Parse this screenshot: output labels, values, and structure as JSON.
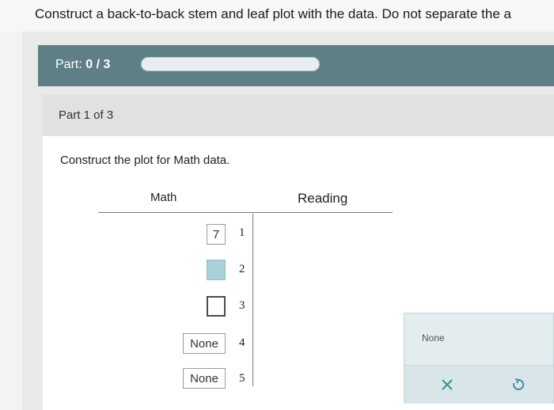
{
  "instruction": "Construct a back-to-back stem and leaf plot with the data. Do not separate the a",
  "part": {
    "label": "Part:",
    "score": "0 / 3",
    "progress": 0
  },
  "section": {
    "header": "Part 1 of 3",
    "prompt": "Construct the plot for Math data."
  },
  "plot": {
    "left_header": "Math",
    "right_header": "Reading",
    "rows": [
      {
        "stem": "1",
        "leaf": "7"
      },
      {
        "stem": "2",
        "leaf": ""
      },
      {
        "stem": "3",
        "leaf": ""
      },
      {
        "stem": "4",
        "leaf": "None"
      },
      {
        "stem": "5",
        "leaf": "None"
      }
    ]
  },
  "palette": {
    "none_label": "None",
    "icons": [
      "close-icon",
      "undo-icon"
    ]
  },
  "colors": {
    "part_bar": "#5f7f86",
    "accent": "#3f8ea0",
    "filled_box": "#a9d2d8"
  }
}
